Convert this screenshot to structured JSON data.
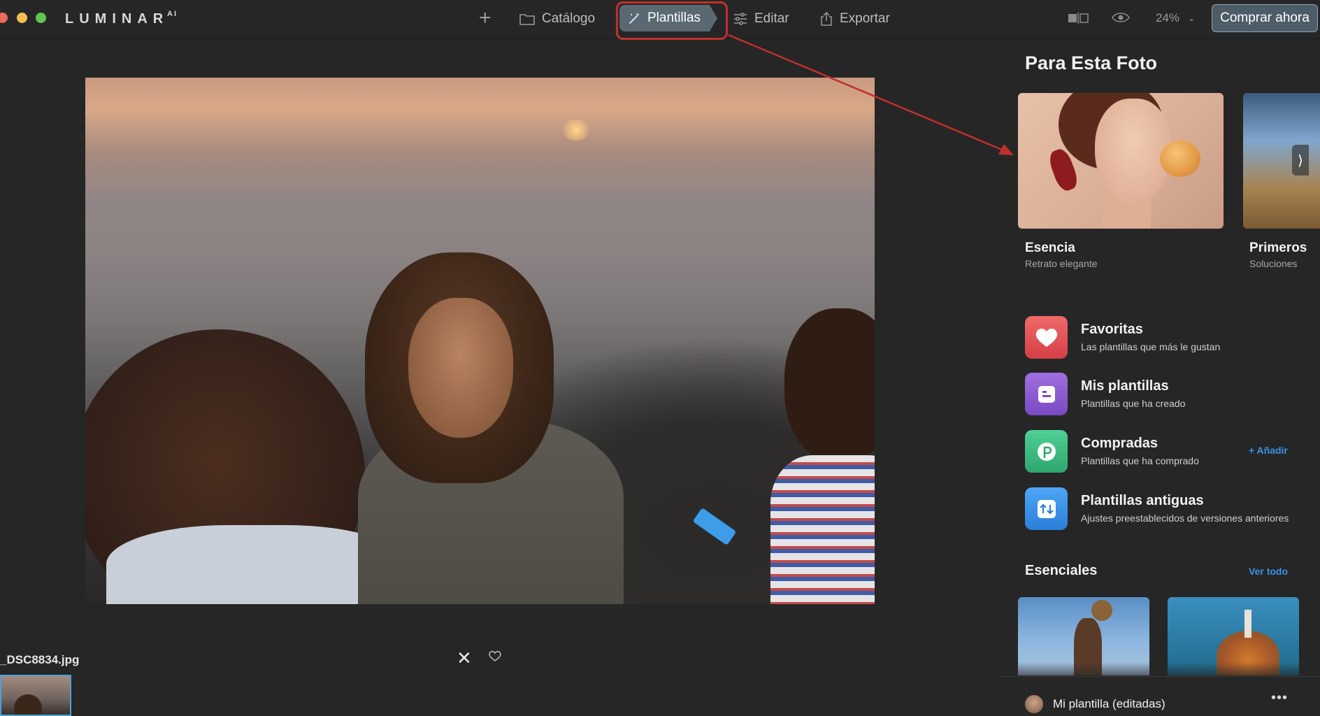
{
  "app": {
    "logo": "LUMINAR",
    "logo_suffix": "AI"
  },
  "toolbar": {
    "catalogo": "Catálogo",
    "plantillas": "Plantillas",
    "editar": "Editar",
    "exportar": "Exportar",
    "zoom": "24%",
    "buy": "Comprar ahora"
  },
  "photo": {
    "filename": "_DSC8834.jpg"
  },
  "panel": {
    "title": "Para Esta Foto",
    "cards": [
      {
        "title": "Esencia",
        "subtitle": "Retrato elegante"
      },
      {
        "title": "Primeros",
        "subtitle": "Soluciones"
      }
    ],
    "list": [
      {
        "title": "Favoritas",
        "subtitle": "Las plantillas que más le gustan"
      },
      {
        "title": "Mis plantillas",
        "subtitle": "Plantillas que ha creado"
      },
      {
        "title": "Compradas",
        "subtitle": "Plantillas que ha comprado"
      },
      {
        "title": "Plantillas antiguas",
        "subtitle": "Ajustes preestablecidos de versiones anteriores"
      }
    ],
    "add_label": "+ Añadir",
    "essentials_title": "Esenciales",
    "see_all": "Ver todo",
    "my_template": "Mi plantilla (editadas)",
    "more": "•••"
  },
  "icons": {
    "plus": "plus-icon",
    "catalog": "folder-icon",
    "templates": "magic-wand-icon",
    "edit": "sliders-icon",
    "export": "share-icon",
    "compare": "compare-icon",
    "preview": "eye-icon",
    "close": "close-icon",
    "favorite": "heart-outline-icon"
  },
  "colors": {
    "accent": "#3a92e4",
    "annotation": "#c0302b",
    "selected_tab": "#5a6872"
  }
}
